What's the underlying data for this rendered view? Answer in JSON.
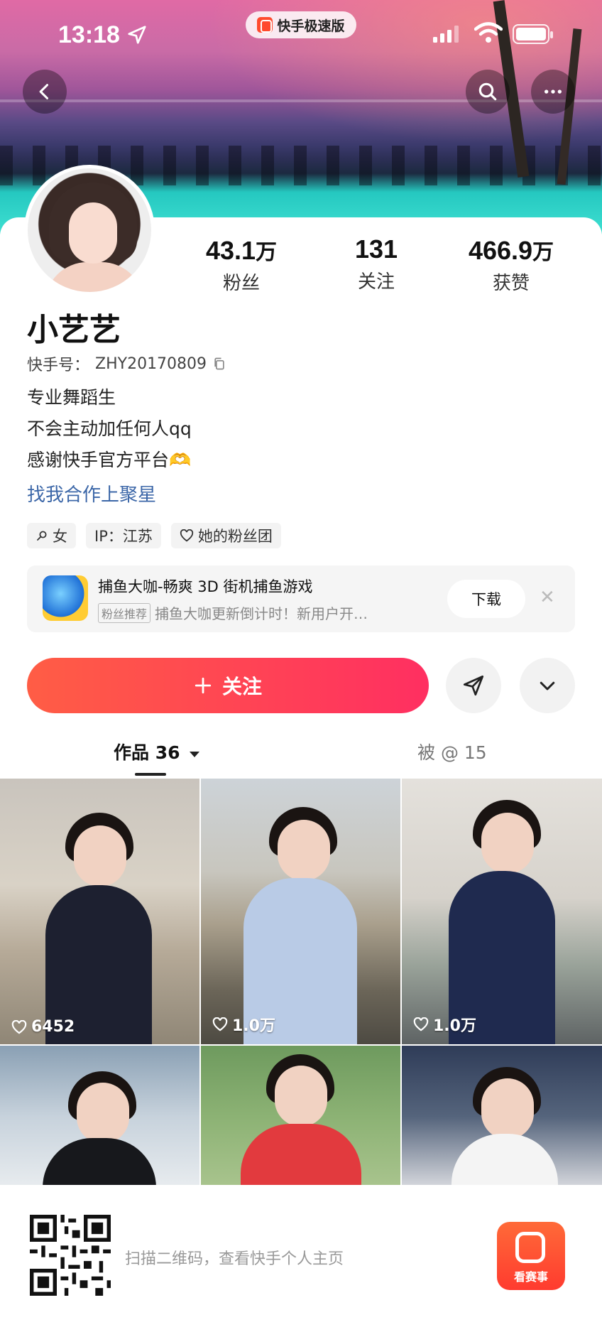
{
  "status_bar": {
    "time": "13:18",
    "app_pill": "快手极速版"
  },
  "profile": {
    "name": "小艺艺",
    "kuaishou_id_label": "快手号：",
    "kuaishou_id": "ZHY20170809",
    "stats": [
      {
        "value": "43.1",
        "unit": "万",
        "label": "粉丝"
      },
      {
        "value": "131",
        "unit": "",
        "label": "关注"
      },
      {
        "value": "466.9",
        "unit": "万",
        "label": "获赞"
      }
    ],
    "bio": [
      "专业舞蹈生",
      "不会主动加任何人qq",
      "感谢快手官方平台"
    ],
    "bio_emoji": "🫶",
    "collab_link": "找我合作上聚星",
    "tags": {
      "gender": "女",
      "ip": "IP：江苏",
      "fan_club": "她的粉丝团"
    }
  },
  "ad": {
    "title": "捕鱼大咖-畅爽 3D 街机捕鱼游戏",
    "badge": "粉丝推荐",
    "subtitle": "捕鱼大咖更新倒计时！新用户开…",
    "button": "下载"
  },
  "actions": {
    "follow_label": "关注"
  },
  "tabs": {
    "works": "作品 36",
    "mentioned": "被 @ 15"
  },
  "videos": [
    {
      "likes": "6452"
    },
    {
      "likes": "1.0万"
    },
    {
      "likes": "1.0万"
    },
    {
      "likes": ""
    },
    {
      "likes": ""
    },
    {
      "likes": ""
    }
  ],
  "bottom": {
    "qr_hint": "扫描二维码，查看快手个人主页",
    "logo_text": "看赛事"
  }
}
